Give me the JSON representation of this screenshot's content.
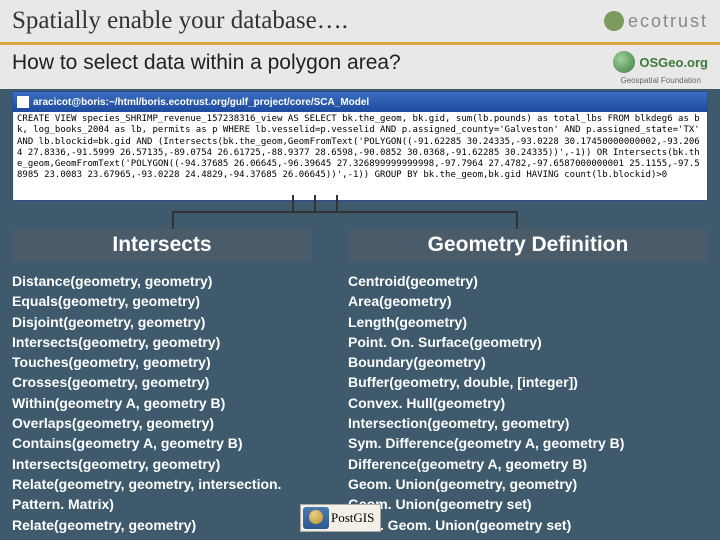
{
  "header": {
    "title": "Spatially enable your database….",
    "brand": "ecotrust"
  },
  "subheader": {
    "subtitle": "How to select data within a polygon area?",
    "osgeo_name": "OSGeo.org",
    "osgeo_sub": "Geospatial Foundation"
  },
  "terminal": {
    "titlebar": "aracicot@boris:~/html/boris.ecotrust.org/gulf_project/core/SCA_Model",
    "sql": "CREATE VIEW species_SHRIMP_revenue_157238316_view AS SELECT bk.the_geom, bk.gid, sum(lb.pounds) as total_lbs FROM blkdeg6 as bk, log_books_2004 as lb, permits as p WHERE lb.vesselid=p.vesselid AND p.assigned_county='Galveston' AND p.assigned_state='TX' AND lb.blockid=bk.gid AND (Intersects(bk.the_geom,GeomFromText('POLYGON((-91.62285 30.24335,-93.0228 30.17450000000002,-93.2064 27.8336,-91.5999 26.57135,-89.0754 26.61725,-88.9377 28.6598,-90.0852 30.0368,-91.62285 30.24335))',-1)) OR Intersects(bk.the_geom,GeomFromText('POLYGON((-94.37685 26.06645,-96.39645 27.326899999999998,-97.7964 27.4782,-97.6587000000001 25.1155,-97.58985 23.0083 23.67965,-93.0228 24.4829,-94.37685 26.06645))',-1)) GROUP BY bk.the_geom,bk.gid HAVING count(lb.blockid)>0"
  },
  "labels": {
    "left": "Intersects",
    "right": "Geometry Definition"
  },
  "functions": {
    "left": [
      "Distance(geometry, geometry)",
      "Equals(geometry, geometry)",
      "Disjoint(geometry, geometry)",
      "Intersects(geometry, geometry)",
      "Touches(geometry, geometry)",
      "Crosses(geometry, geometry)",
      "Within(geometry A, geometry B)",
      "Overlaps(geometry, geometry)",
      "Contains(geometry A, geometry B)",
      "Intersects(geometry, geometry)",
      "Relate(geometry, geometry, intersection. Pattern. Matrix)",
      "Relate(geometry, geometry)"
    ],
    "right": [
      "Centroid(geometry)",
      "Area(geometry)",
      "Length(geometry)",
      "Point. On. Surface(geometry)",
      "Boundary(geometry)",
      "Buffer(geometry, double, [integer])",
      "Convex. Hull(geometry)",
      "Intersection(geometry, geometry)",
      "Sym. Difference(geometry A, geometry B)",
      "Difference(geometry A, geometry B)",
      "Geom. Union(geometry, geometry)",
      "Geom. Union(geometry set)",
      "Mem. Geom. Union(geometry set)"
    ]
  },
  "postgis": {
    "label": "PostGIS"
  }
}
